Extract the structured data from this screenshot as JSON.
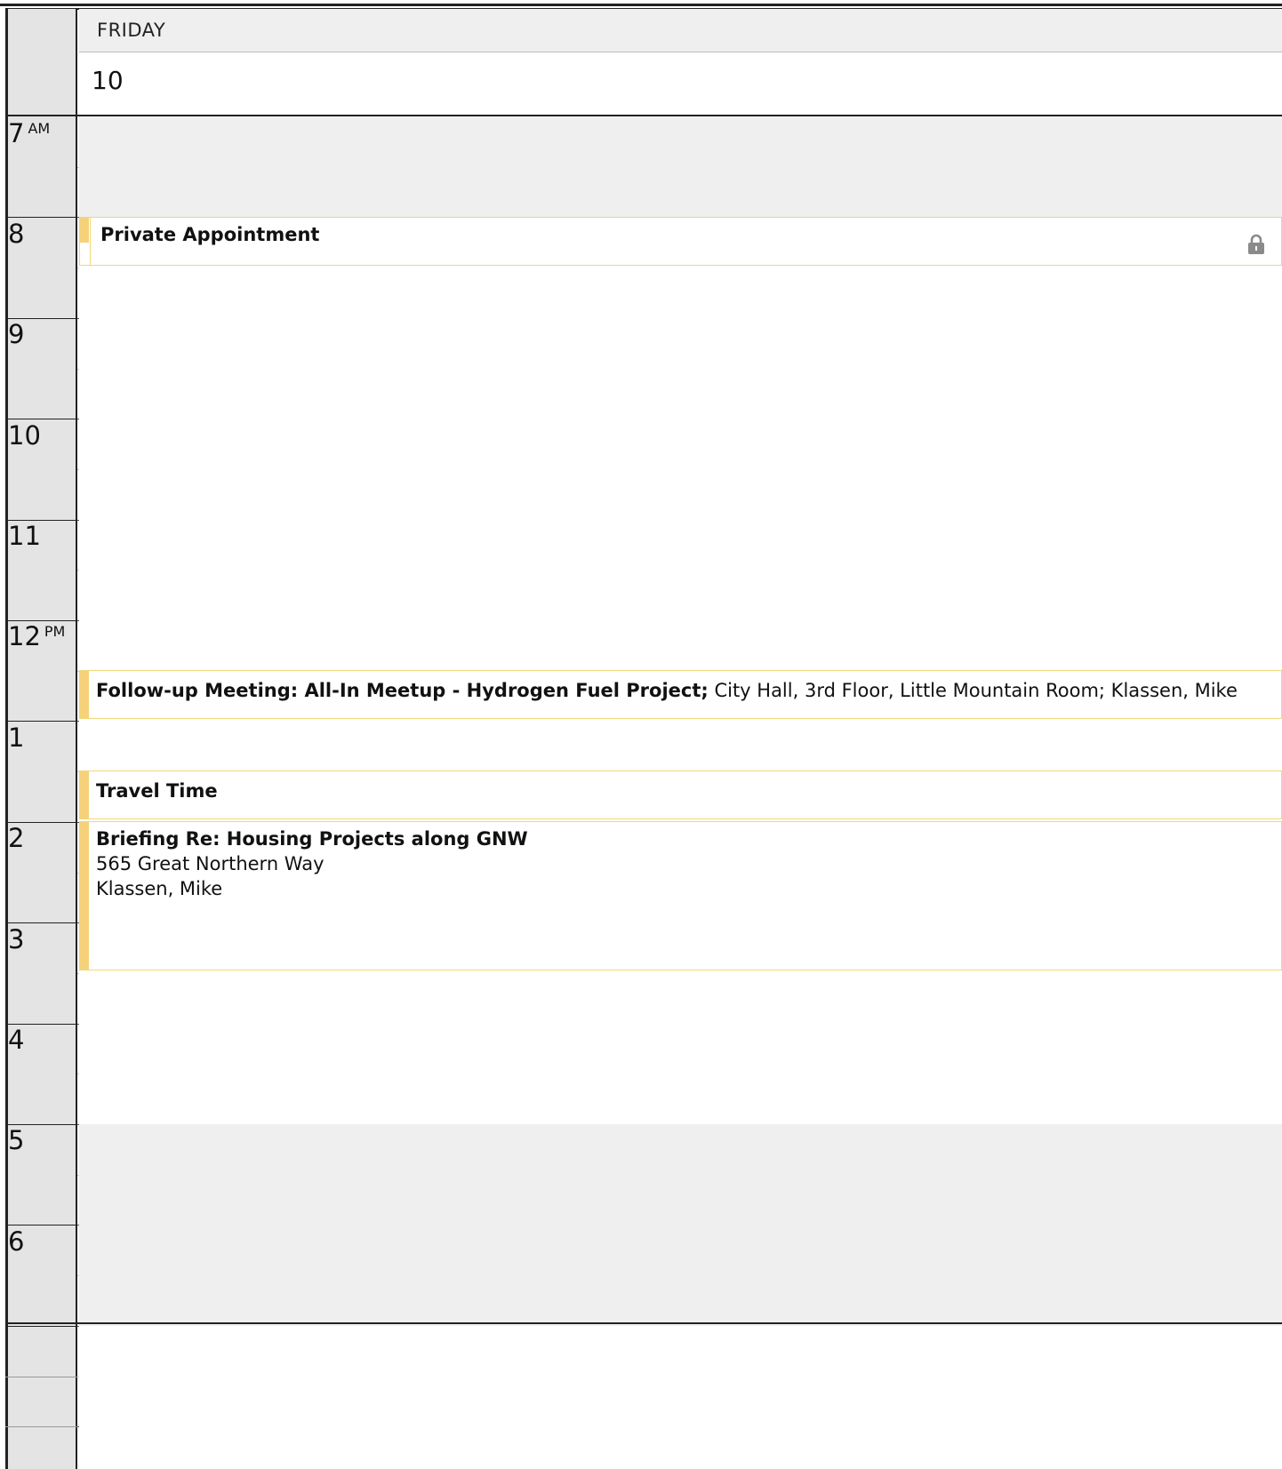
{
  "day": {
    "name": "FRIDAY",
    "number": "10"
  },
  "hours": [
    {
      "label": "7",
      "ampm": "AM"
    },
    {
      "label": "8",
      "ampm": ""
    },
    {
      "label": "9",
      "ampm": ""
    },
    {
      "label": "10",
      "ampm": ""
    },
    {
      "label": "11",
      "ampm": ""
    },
    {
      "label": "12",
      "ampm": "PM"
    },
    {
      "label": "1",
      "ampm": ""
    },
    {
      "label": "2",
      "ampm": ""
    },
    {
      "label": "3",
      "ampm": ""
    },
    {
      "label": "4",
      "ampm": ""
    },
    {
      "label": "5",
      "ampm": ""
    },
    {
      "label": "6",
      "ampm": ""
    }
  ],
  "events": {
    "private": {
      "title": "Private Appointment",
      "icon": "lock-icon"
    },
    "followup": {
      "title": "Follow-up Meeting: All-In Meetup - Hydrogen Fuel Project;",
      "details": " City Hall, 3rd Floor, Little Mountain Room; Klassen, Mike"
    },
    "travel": {
      "title": "Travel Time"
    },
    "briefing": {
      "title": "Briefing Re: Housing Projects along GNW",
      "location": "565 Great Northern Way",
      "organizer": "Klassen, Mike"
    }
  },
  "colors": {
    "event_bar": "#f5d27a",
    "event_border": "#f0d77a",
    "offhours_bg": "#efefef",
    "gutter_bg": "#e4e4e4"
  }
}
